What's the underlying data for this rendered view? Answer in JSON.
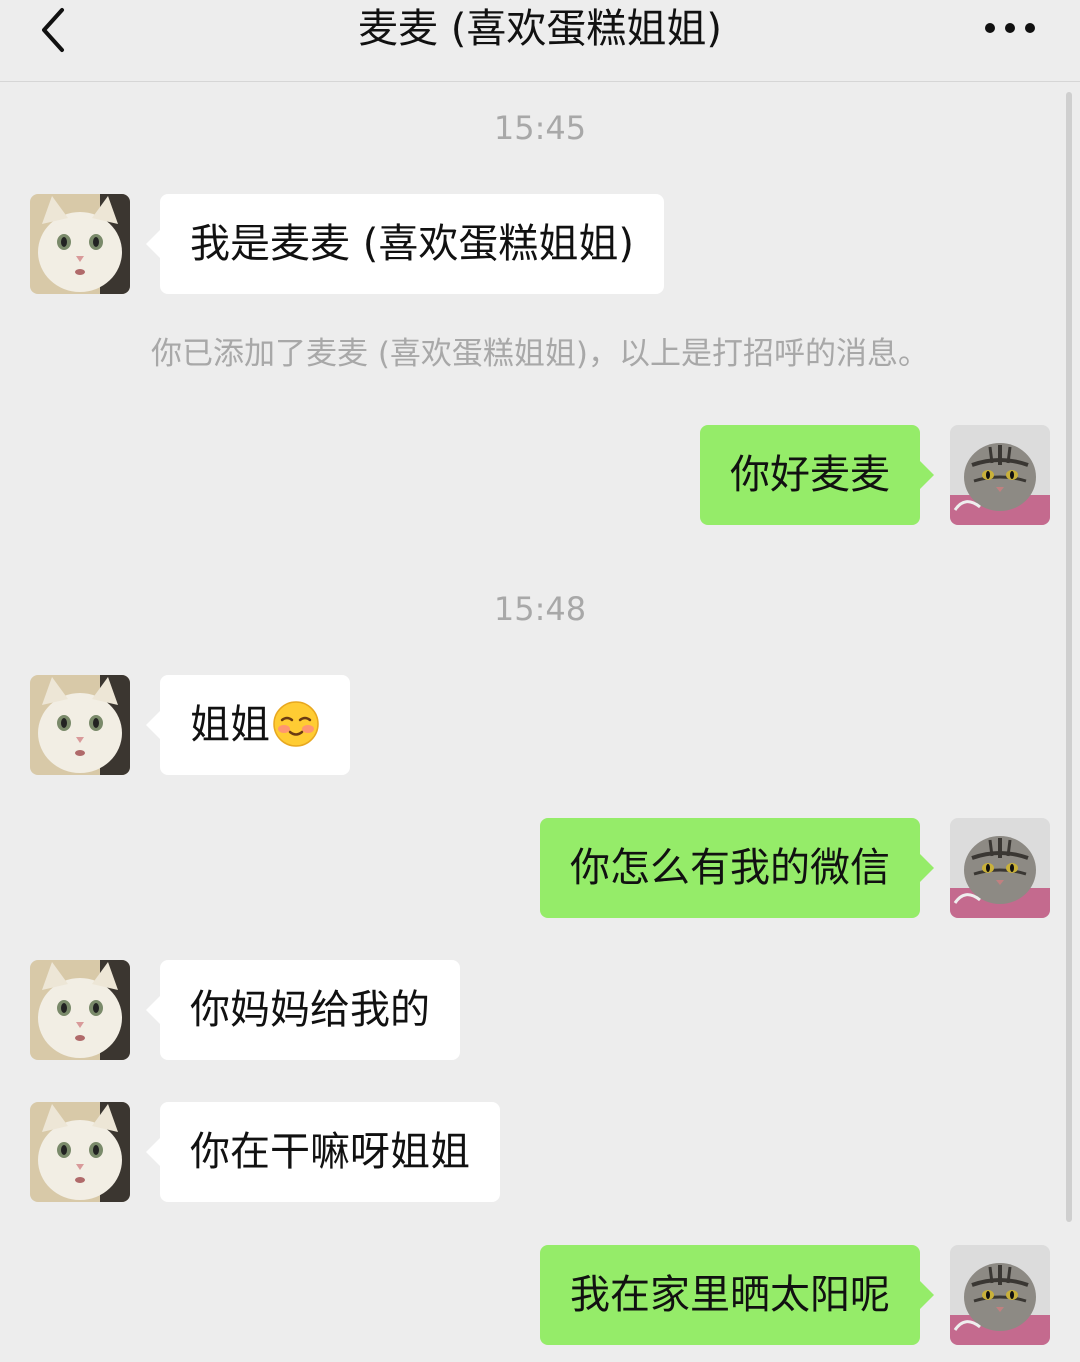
{
  "header": {
    "title": "麦麦 (喜欢蛋糕姐姐)",
    "back_icon": "chevron-left-icon",
    "more_icon": "more-dots-icon"
  },
  "messages": [
    {
      "type": "timestamp",
      "text": "15:45"
    },
    {
      "type": "incoming",
      "text": "我是麦麦 (喜欢蛋糕姐姐)"
    },
    {
      "type": "system",
      "text": "你已添加了麦麦 (喜欢蛋糕姐姐)，以上是打招呼的消息。"
    },
    {
      "type": "outgoing",
      "text": "你好麦麦"
    },
    {
      "type": "timestamp",
      "text": "15:48"
    },
    {
      "type": "incoming",
      "text": "姐姐",
      "emoji": "shy-smile-emoji"
    },
    {
      "type": "outgoing",
      "text": "你怎么有我的微信"
    },
    {
      "type": "incoming",
      "text": "你妈妈给我的"
    },
    {
      "type": "incoming",
      "text": "你在干嘛呀姐姐"
    },
    {
      "type": "outgoing",
      "text": "我在家里晒太阳呢"
    }
  ],
  "colors": {
    "background": "#ededed",
    "outgoing_bubble": "#95ec69",
    "incoming_bubble": "#ffffff",
    "meta_text": "#a8a8a8"
  }
}
